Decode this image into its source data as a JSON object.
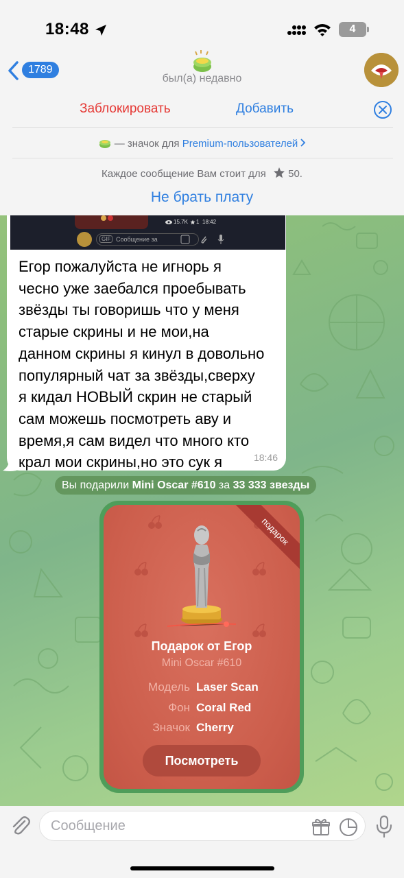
{
  "status_bar": {
    "time": "18:48",
    "battery": "4"
  },
  "header": {
    "back_count": "1789",
    "status": "был(а) недавно"
  },
  "action_panel": {
    "block_label": "Заблокировать",
    "add_label": "Добавить",
    "premium_prefix": "— значок для",
    "premium_link": "Premium-пользователей",
    "pay_notice": "Каждое сообщение Вам стоит для",
    "pay_amount": "50.",
    "no_pay_label": "Не брать плату"
  },
  "embedded_screenshot": {
    "views": "15.7K",
    "stars": "1",
    "time": "18:42",
    "gif_label": "GIF",
    "input_placeholder": "Сообщение за"
  },
  "message": {
    "lines": [
      "Егор пожалуйста не игнорь я",
      "чесно уже заебался проебывать",
      "звёзды ты говоришь что у меня",
      "старые скрины и не мои,на",
      "данном скрины я кинул в довольно",
      "популярный чат за звёзды,сверху",
      "я кидал НОВЫЙ скрин не старый",
      "сам можешь посмотреть аву и",
      "время,я сам видел что много кто",
      "крал мои скрины,но это сук я"
    ],
    "time": "18:46"
  },
  "service_message": {
    "prefix": "Вы подарили",
    "gift_name": "Mini Oscar #610",
    "middle": "за",
    "amount": "33 333 звезды"
  },
  "gift": {
    "ribbon": "подарок",
    "title": "Подарок от Егор",
    "subtitle": "Mini Oscar #610",
    "attributes": [
      {
        "key": "Модель",
        "value": "Laser Scan"
      },
      {
        "key": "Фон",
        "value": "Coral Red"
      },
      {
        "key": "Значок",
        "value": "Cherry"
      }
    ],
    "view_button": "Посмотреть",
    "background_color": "#cc5e4c"
  },
  "input_bar": {
    "placeholder": "Сообщение"
  },
  "colors": {
    "accent": "#2f7fe0",
    "danger": "#e53935"
  }
}
